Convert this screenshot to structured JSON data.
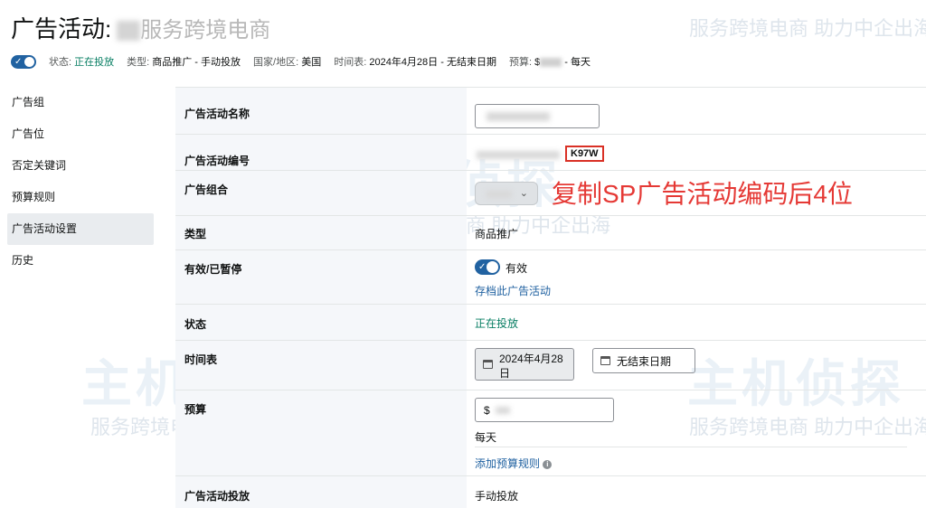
{
  "header": {
    "title_prefix": "广告活动:",
    "title_suffix": "服务跨境电商"
  },
  "watermark": {
    "slogan": "服务跨境电商 助力中企出海",
    "brand": "主机侦探"
  },
  "statusbar": {
    "status_label": "状态:",
    "status_value": "正在投放",
    "type_label": "类型:",
    "type_value": "商品推广 - 手动投放",
    "country_label": "国家/地区:",
    "country_value": "美国",
    "schedule_label": "时间表:",
    "schedule_value": "2024年4月28日 - 无结束日期",
    "budget_label": "预算:",
    "budget_prefix": "$",
    "budget_suffix": "- 每天"
  },
  "sidebar": {
    "items": [
      {
        "label": "广告组"
      },
      {
        "label": "广告位"
      },
      {
        "label": "否定关键词"
      },
      {
        "label": "预算规则"
      },
      {
        "label": "广告活动设置"
      },
      {
        "label": "历史"
      }
    ],
    "active_index": 4
  },
  "settings": {
    "campaign_name_label": "广告活动名称",
    "campaign_id_label": "广告活动编号",
    "campaign_id_suffix": "K97W",
    "portfolio_label": "广告组合",
    "type_label": "类型",
    "type_value": "商品推广",
    "active_label": "有效/已暂停",
    "active_value": "有效",
    "archive_link": "存档此广告活动",
    "status_label": "状态",
    "status_value": "正在投放",
    "schedule_label": "时间表",
    "start_date": "2024年4月28日",
    "end_date": "无结束日期",
    "budget_label": "预算",
    "budget_currency": "$",
    "budget_period": "每天",
    "add_budget_rule": "添加预算规则",
    "targeting_label": "广告活动投放",
    "targeting_value": "手动投放"
  },
  "annotation": {
    "text": "复制SP广告活动编码后4位",
    "color": "#e53935"
  },
  "colors": {
    "accent": "#2162a1",
    "success": "#067d62",
    "label_bg": "#f5f7fa"
  }
}
